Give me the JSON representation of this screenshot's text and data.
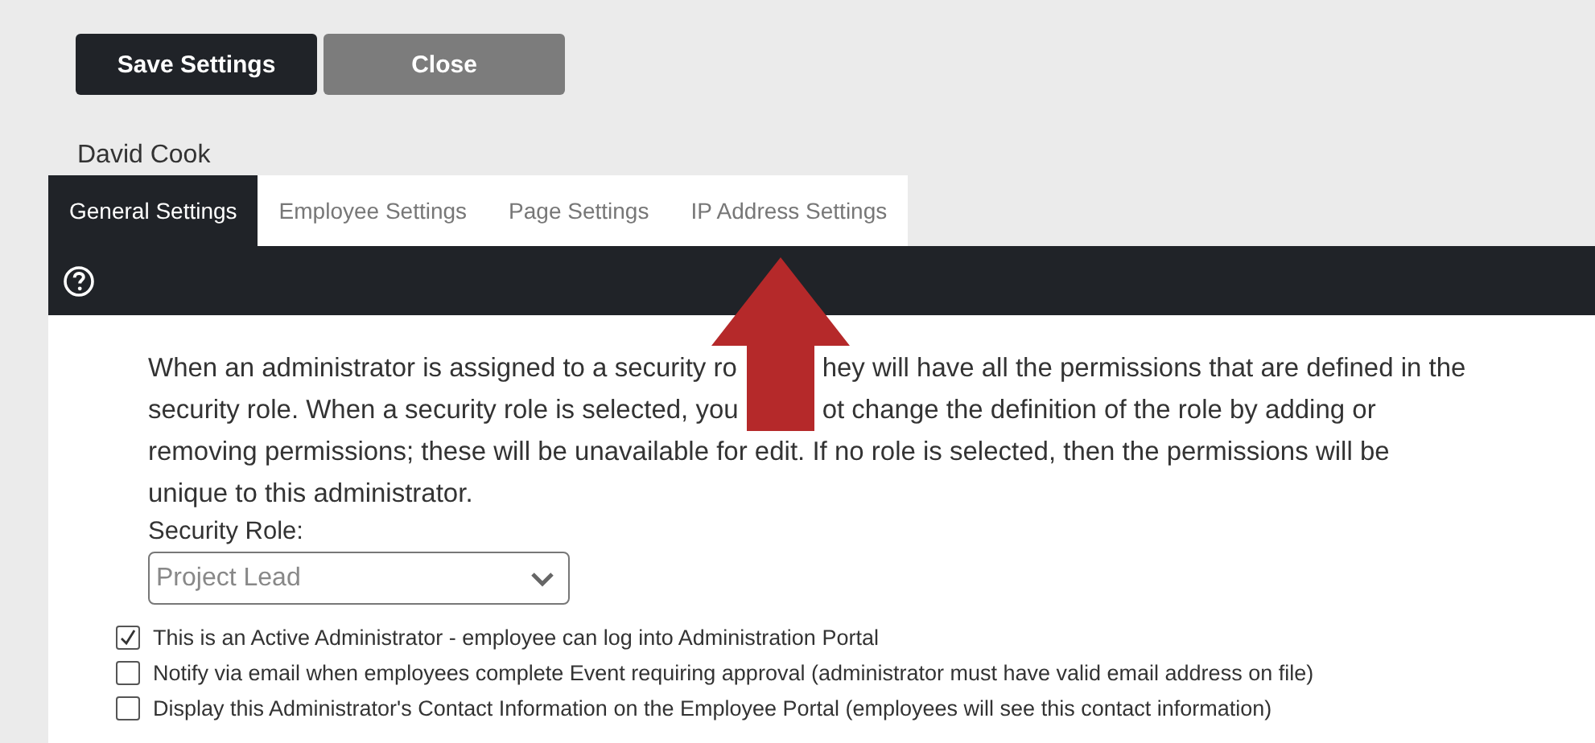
{
  "buttons": [
    {
      "label": "Save Settings",
      "kind": "primary"
    },
    {
      "label": "Close",
      "kind": "secondary"
    }
  ],
  "employee_name": "David Cook",
  "tabs": [
    {
      "label": "General Settings",
      "selected": true
    },
    {
      "label": "Employee Settings",
      "selected": false
    },
    {
      "label": "Page Settings",
      "selected": false
    },
    {
      "label": "IP Address Settings",
      "selected": false
    }
  ],
  "description": {
    "lines": [
      [
        "When an administrator is assigned to a security ro",
        "hey will have all the permissions that are defined in the"
      ],
      [
        "security role. When a security role is selected, you",
        "ot change the definition of the role by adding or"
      ],
      [
        "removing permissions; these will be unavailable for edit. If no role is selected, then the permissions will be"
      ],
      [
        "unique to this administrator."
      ]
    ]
  },
  "security_role": {
    "label": "Security Role:",
    "value": "Project Lead"
  },
  "options": [
    {
      "label": "This is an Active Administrator - employee can log into Administration Portal",
      "checked": true
    },
    {
      "label": "Notify via email when employees complete Event requiring approval (administrator must have valid email address on file)",
      "checked": false
    },
    {
      "label": "Display this Administrator's Contact Information on the Employee Portal (employees will see this contact information)",
      "checked": false
    }
  ]
}
